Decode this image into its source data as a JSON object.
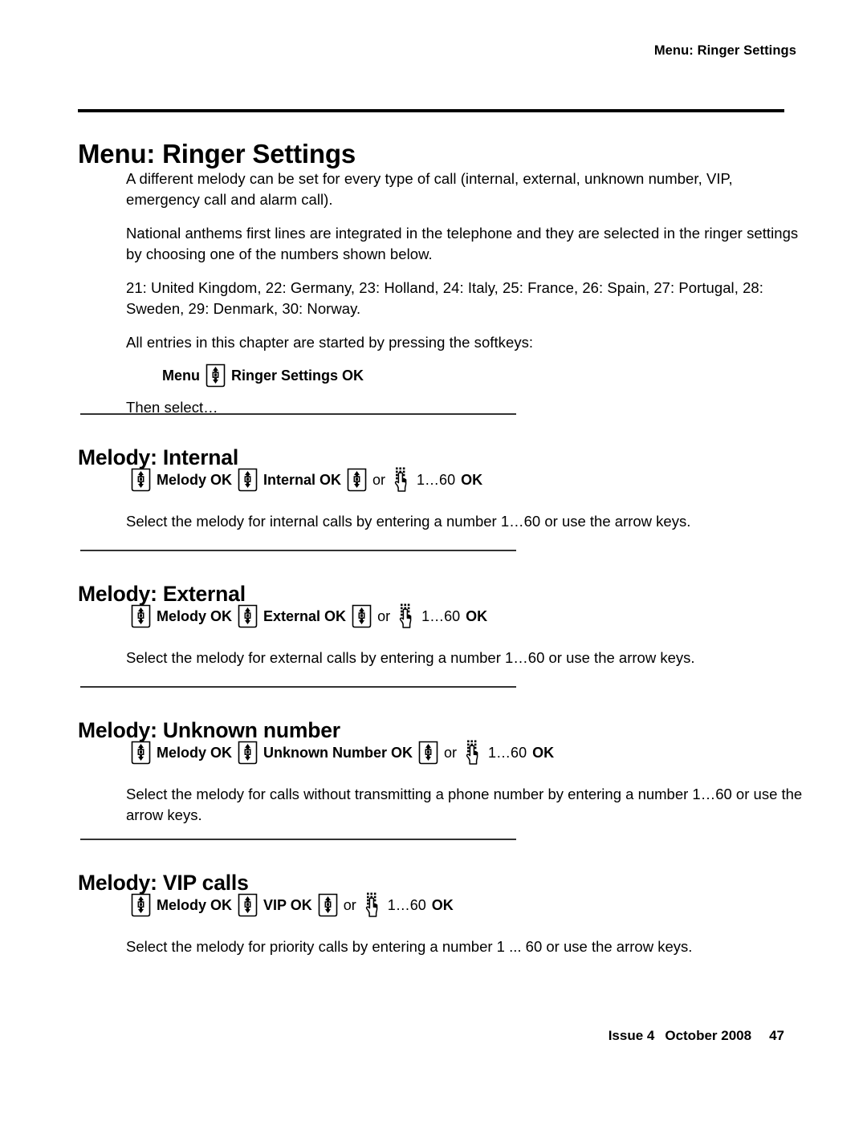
{
  "header": {
    "running_title": "Menu: Ringer Settings"
  },
  "chapter": {
    "title": "Menu: Ringer Settings",
    "paragraphs": [
      "A different melody can be set for every type of call (internal, external, unknown number, VIP, emergency call and alarm call).",
      "National anthems first lines are integrated in the telephone and they are selected in the ringer settings by choosing one of the numbers shown below.",
      "21: United Kingdom, 22: Germany, 23: Holland, 24: Italy, 25: France, 26: Spain, 27: Portugal, 28: Sweden, 29: Denmark, 30: Norway.",
      "All entries in this chapter are started by pressing the softkeys:"
    ],
    "softkey_line": {
      "before_key": "Menu",
      "nav_icon": "nav-rocker-key-icon",
      "after_key": "Ringer Settings OK"
    },
    "then_select": "Then select…"
  },
  "sections": [
    {
      "title": "Melody: Internal",
      "keys": {
        "nav_icon_1": "nav-rocker-key-icon",
        "label_1": "Melody OK",
        "nav_icon_2": "nav-rocker-key-icon",
        "label_2": "Internal OK",
        "nav_icon_3": "nav-rocker-key-icon",
        "or": "or",
        "keypad_icon": "keypad-hand-icon",
        "range": "1…60",
        "confirm": "OK"
      },
      "description": "Select the melody for internal calls by entering a number 1…60 or use the arrow keys."
    },
    {
      "title": "Melody: External",
      "keys": {
        "nav_icon_1": "nav-rocker-key-icon",
        "label_1": "Melody OK",
        "nav_icon_2": "nav-rocker-key-icon",
        "label_2": "External OK",
        "nav_icon_3": "nav-rocker-key-icon",
        "or": "or",
        "keypad_icon": "keypad-hand-icon",
        "range": "1…60",
        "confirm": "OK"
      },
      "description": "Select the melody for external calls by entering a number 1…60 or use the arrow keys."
    },
    {
      "title": "Melody: Unknown number",
      "keys": {
        "nav_icon_1": "nav-rocker-key-icon",
        "label_1": "Melody OK",
        "nav_icon_2": "nav-rocker-key-icon",
        "label_2": "Unknown Number OK",
        "nav_icon_3": "nav-rocker-key-icon",
        "or": "or",
        "keypad_icon": "keypad-hand-icon",
        "range": "1…60",
        "confirm": "OK"
      },
      "description": "Select the melody for calls without transmitting a phone number by entering a number 1…60 or use the arrow keys."
    },
    {
      "title": "Melody: VIP calls",
      "keys": {
        "nav_icon_1": "nav-rocker-key-icon",
        "label_1": "Melody OK",
        "nav_icon_2": "nav-rocker-key-icon",
        "label_2": "VIP OK",
        "nav_icon_3": "nav-rocker-key-icon",
        "or": "or",
        "keypad_icon": "keypad-hand-icon",
        "range": "1…60",
        "confirm": "OK"
      },
      "description": "Select the melody for priority calls by entering a number 1 ... 60 or use the arrow keys."
    }
  ],
  "footer": {
    "issue": "Issue 4",
    "date": "October 2008",
    "page_number": "47"
  },
  "colors": {
    "text": "#000000",
    "rule": "#000000",
    "section_rule": "#333333",
    "background": "#ffffff"
  }
}
